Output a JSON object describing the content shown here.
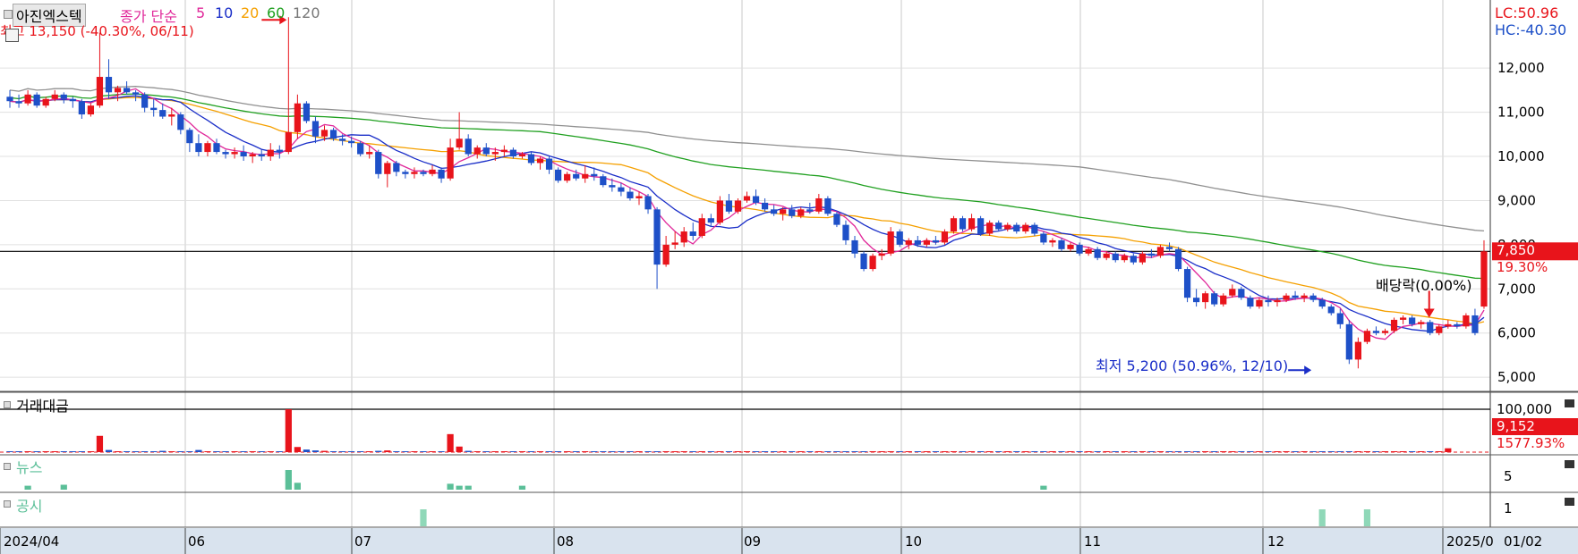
{
  "header": {
    "stock_name": "아진엑스텍",
    "ma_title": "종가 단순",
    "ma_periods": [
      "5",
      "10",
      "20",
      "60",
      "120"
    ],
    "high_marker": "최고 13,150 (-40.30%, 06/11)"
  },
  "right_info": {
    "lc": "LC:50.96",
    "hc": "HC:-40.30",
    "price_label": "7,850",
    "price_change": "19.30%",
    "dividend": "배당락(0.00%)"
  },
  "low_marker": "최저 5,200 (50.96%, 12/10)",
  "panels": {
    "volume_title": "거래대금",
    "volume_axis": "100,000",
    "volume_value": "9,152",
    "volume_change": "1577.93%",
    "news_title": "뉴스",
    "news_axis": "5",
    "disclosure_title": "공시",
    "disclosure_axis": "1"
  },
  "x_axis_labels": [
    "2024/04",
    "06",
    "07",
    "08",
    "09",
    "10",
    "11",
    "12",
    "2025/0",
    "01/02"
  ],
  "colors": {
    "up": "#e8141b",
    "down": "#1e50c8",
    "ma5": "#e0289a",
    "ma10": "#1a2ec8",
    "ma20": "#f5a000",
    "ma60": "#20a020",
    "ma120": "#909090",
    "news": "#5bbf98"
  },
  "chart_data": {
    "type": "candlestick",
    "y_ticks": [
      "12,000",
      "11,000",
      "10,000",
      "9,000",
      "8,000",
      "7,000",
      "6,000",
      "5,000"
    ],
    "ylim": [
      4700,
      13500
    ],
    "reference_price": 7850,
    "candles": [
      [
        11350,
        11500,
        11100,
        11250
      ],
      [
        11250,
        11400,
        11100,
        11200
      ],
      [
        11200,
        11500,
        11150,
        11400
      ],
      [
        11400,
        11450,
        11100,
        11150
      ],
      [
        11150,
        11350,
        11100,
        11300
      ],
      [
        11300,
        11500,
        11250,
        11400
      ],
      [
        11400,
        11450,
        11200,
        11300
      ],
      [
        11300,
        11350,
        11100,
        11250
      ],
      [
        11250,
        11300,
        10850,
        10950
      ],
      [
        10950,
        11200,
        10900,
        11150
      ],
      [
        11150,
        12800,
        11100,
        11800
      ],
      [
        11800,
        12200,
        11300,
        11450
      ],
      [
        11450,
        11600,
        11250,
        11550
      ],
      [
        11550,
        11700,
        11400,
        11450
      ],
      [
        11450,
        11500,
        11250,
        11400
      ],
      [
        11400,
        11450,
        11000,
        11100
      ],
      [
        11100,
        11300,
        10900,
        11050
      ],
      [
        11050,
        11200,
        10850,
        10900
      ],
      [
        10900,
        11100,
        10700,
        10950
      ],
      [
        10950,
        11000,
        10500,
        10600
      ],
      [
        10600,
        10650,
        10100,
        10300
      ],
      [
        10300,
        10500,
        10000,
        10100
      ],
      [
        10100,
        10350,
        10000,
        10300
      ],
      [
        10300,
        10400,
        10050,
        10100
      ],
      [
        10100,
        10150,
        9950,
        10050
      ],
      [
        10050,
        10200,
        9950,
        10100
      ],
      [
        10100,
        10250,
        9900,
        10000
      ],
      [
        10000,
        10100,
        9850,
        10050
      ],
      [
        10050,
        10150,
        9900,
        10000
      ],
      [
        10000,
        10300,
        9900,
        10150
      ],
      [
        10150,
        10250,
        9950,
        10100
      ],
      [
        10100,
        13150,
        10050,
        10550
      ],
      [
        10550,
        11400,
        10400,
        11200
      ],
      [
        11200,
        11250,
        10750,
        10800
      ],
      [
        10800,
        10900,
        10300,
        10450
      ],
      [
        10450,
        10700,
        10350,
        10600
      ],
      [
        10600,
        10650,
        10350,
        10400
      ],
      [
        10400,
        10500,
        10250,
        10350
      ],
      [
        10350,
        10450,
        10200,
        10300
      ],
      [
        10300,
        10350,
        10000,
        10050
      ],
      [
        10050,
        10250,
        9950,
        10100
      ],
      [
        10100,
        10150,
        9500,
        9600
      ],
      [
        9600,
        9900,
        9300,
        9850
      ],
      [
        9850,
        9900,
        9550,
        9650
      ],
      [
        9650,
        9700,
        9500,
        9600
      ],
      [
        9600,
        9750,
        9500,
        9650
      ],
      [
        9650,
        9700,
        9550,
        9600
      ],
      [
        9600,
        9800,
        9550,
        9700
      ],
      [
        9700,
        9750,
        9400,
        9500
      ],
      [
        9500,
        10400,
        9450,
        10200
      ],
      [
        10200,
        11000,
        10150,
        10400
      ],
      [
        10400,
        10500,
        10000,
        10050
      ],
      [
        10050,
        10250,
        9950,
        10200
      ],
      [
        10200,
        10300,
        10000,
        10050
      ],
      [
        10050,
        10200,
        9900,
        10100
      ],
      [
        10100,
        10250,
        10000,
        10150
      ],
      [
        10150,
        10200,
        9950,
        10000
      ],
      [
        10000,
        10100,
        9950,
        10050
      ],
      [
        10050,
        10100,
        9800,
        9850
      ],
      [
        9850,
        10000,
        9700,
        9950
      ],
      [
        9950,
        10000,
        9600,
        9700
      ],
      [
        9700,
        9750,
        9400,
        9450
      ],
      [
        9450,
        9650,
        9400,
        9600
      ],
      [
        9600,
        9700,
        9450,
        9500
      ],
      [
        9500,
        9800,
        9400,
        9600
      ],
      [
        9600,
        9750,
        9450,
        9550
      ],
      [
        9550,
        9600,
        9300,
        9350
      ],
      [
        9350,
        9500,
        9200,
        9300
      ],
      [
        9300,
        9400,
        9100,
        9200
      ],
      [
        9200,
        9300,
        9000,
        9050
      ],
      [
        9050,
        9200,
        8900,
        9100
      ],
      [
        9100,
        9150,
        8700,
        8800
      ],
      [
        8800,
        8850,
        7000,
        7550
      ],
      [
        7550,
        8200,
        7500,
        8000
      ],
      [
        8000,
        8300,
        7900,
        8050
      ],
      [
        8050,
        8400,
        7950,
        8300
      ],
      [
        8300,
        8500,
        8100,
        8200
      ],
      [
        8200,
        8700,
        8150,
        8600
      ],
      [
        8600,
        8700,
        8400,
        8500
      ],
      [
        8500,
        9100,
        8450,
        9000
      ],
      [
        9000,
        9150,
        8700,
        8750
      ],
      [
        8750,
        9050,
        8700,
        9000
      ],
      [
        9000,
        9200,
        8950,
        9100
      ],
      [
        9100,
        9250,
        8900,
        8950
      ],
      [
        8950,
        9050,
        8750,
        8800
      ],
      [
        8800,
        8900,
        8650,
        8700
      ],
      [
        8700,
        8850,
        8550,
        8800
      ],
      [
        8800,
        8900,
        8600,
        8650
      ],
      [
        8650,
        8850,
        8600,
        8800
      ],
      [
        8800,
        8950,
        8700,
        8750
      ],
      [
        8750,
        9150,
        8700,
        9050
      ],
      [
        9050,
        9100,
        8650,
        8700
      ],
      [
        8700,
        8750,
        8400,
        8450
      ],
      [
        8450,
        8550,
        8000,
        8100
      ],
      [
        8100,
        8200,
        7700,
        7800
      ],
      [
        7800,
        7850,
        7400,
        7450
      ],
      [
        7450,
        7800,
        7400,
        7750
      ],
      [
        7750,
        7900,
        7650,
        7800
      ],
      [
        7800,
        8400,
        7750,
        8300
      ],
      [
        8300,
        8350,
        7950,
        8000
      ],
      [
        8000,
        8150,
        7900,
        8100
      ],
      [
        8100,
        8200,
        7950,
        8000
      ],
      [
        8000,
        8150,
        7950,
        8100
      ],
      [
        8100,
        8200,
        8000,
        8050
      ],
      [
        8050,
        8350,
        8000,
        8300
      ],
      [
        8300,
        8650,
        8250,
        8600
      ],
      [
        8600,
        8650,
        8300,
        8350
      ],
      [
        8350,
        8700,
        8300,
        8600
      ],
      [
        8600,
        8650,
        8200,
        8250
      ],
      [
        8250,
        8550,
        8200,
        8500
      ],
      [
        8500,
        8550,
        8300,
        8350
      ],
      [
        8350,
        8500,
        8300,
        8450
      ],
      [
        8450,
        8500,
        8250,
        8300
      ],
      [
        8300,
        8500,
        8250,
        8450
      ],
      [
        8450,
        8500,
        8200,
        8250
      ],
      [
        8250,
        8300,
        8000,
        8050
      ],
      [
        8050,
        8150,
        7950,
        8100
      ],
      [
        8100,
        8150,
        7850,
        7900
      ],
      [
        7900,
        8050,
        7850,
        8000
      ],
      [
        8000,
        8050,
        7750,
        7800
      ],
      [
        7800,
        7950,
        7750,
        7900
      ],
      [
        7900,
        7950,
        7650,
        7700
      ],
      [
        7700,
        7850,
        7650,
        7800
      ],
      [
        7800,
        7850,
        7600,
        7650
      ],
      [
        7650,
        7800,
        7600,
        7750
      ],
      [
        7750,
        7800,
        7550,
        7600
      ],
      [
        7600,
        7850,
        7550,
        7800
      ],
      [
        7800,
        7900,
        7700,
        7750
      ],
      [
        7750,
        8000,
        7700,
        7950
      ],
      [
        7950,
        8050,
        7850,
        7900
      ],
      [
        7900,
        7950,
        7400,
        7450
      ],
      [
        7450,
        7500,
        6700,
        6800
      ],
      [
        6800,
        7000,
        6600,
        6700
      ],
      [
        6700,
        6950,
        6550,
        6900
      ],
      [
        6900,
        6950,
        6600,
        6650
      ],
      [
        6650,
        6900,
        6600,
        6850
      ],
      [
        6850,
        7100,
        6800,
        7000
      ],
      [
        7000,
        7050,
        6750,
        6800
      ],
      [
        6800,
        6850,
        6550,
        6600
      ],
      [
        6600,
        6800,
        6550,
        6750
      ],
      [
        6750,
        6850,
        6600,
        6700
      ],
      [
        6700,
        6800,
        6600,
        6750
      ],
      [
        6750,
        6900,
        6700,
        6850
      ],
      [
        6850,
        6950,
        6750,
        6800
      ],
      [
        6800,
        6900,
        6700,
        6850
      ],
      [
        6850,
        6900,
        6700,
        6750
      ],
      [
        6750,
        6800,
        6550,
        6600
      ],
      [
        6600,
        6650,
        6400,
        6450
      ],
      [
        6450,
        6550,
        6100,
        6200
      ],
      [
        6200,
        6300,
        5300,
        5400
      ],
      [
        5400,
        5900,
        5200,
        5800
      ],
      [
        5800,
        6100,
        5750,
        6050
      ],
      [
        6050,
        6150,
        5950,
        6000
      ],
      [
        6000,
        6100,
        5950,
        6050
      ],
      [
        6050,
        6350,
        6000,
        6300
      ],
      [
        6300,
        6400,
        6200,
        6350
      ],
      [
        6350,
        6400,
        6150,
        6200
      ],
      [
        6200,
        6300,
        6100,
        6250
      ],
      [
        6250,
        6300,
        5950,
        6000
      ],
      [
        6000,
        6200,
        5950,
        6150
      ],
      [
        6150,
        6300,
        6100,
        6200
      ],
      [
        6200,
        6250,
        6100,
        6150
      ],
      [
        6150,
        6450,
        6100,
        6400
      ],
      [
        6400,
        6550,
        5950,
        6000
      ],
      [
        6600,
        8100,
        6550,
        7850
      ]
    ],
    "volume": [
      0.02,
      0.01,
      0.01,
      0.01,
      0.01,
      0.01,
      0.01,
      0.01,
      0.01,
      0.01,
      0.38,
      0.05,
      0.02,
      0.02,
      0.01,
      0.01,
      0.01,
      0.03,
      0.01,
      0.01,
      0.02,
      0.05,
      0.01,
      0.01,
      0.01,
      0.01,
      0.01,
      0.01,
      0.01,
      0.01,
      0.01,
      1.0,
      0.12,
      0.06,
      0.04,
      0.03,
      0.02,
      0.02,
      0.02,
      0.01,
      0.01,
      0.03,
      0.04,
      0.02,
      0.01,
      0.01,
      0.01,
      0.01,
      0.01,
      0.42,
      0.13,
      0.03,
      0.01,
      0.01,
      0.01,
      0.01,
      0.01,
      0.02,
      0.01,
      0.01,
      0.01,
      0.01,
      0.01,
      0.01,
      0.01,
      0.01,
      0.01,
      0.01,
      0.01,
      0.01,
      0.01,
      0.01,
      0.01,
      0.01,
      0.01,
      0.01,
      0.01,
      0.01,
      0.01,
      0.01,
      0.01,
      0.01,
      0.01,
      0.01,
      0.01,
      0.01,
      0.01,
      0.01,
      0.01,
      0.01,
      0.01,
      0.01,
      0.01,
      0.01,
      0.01,
      0.01,
      0.01,
      0.01,
      0.01,
      0.01,
      0.01,
      0.01,
      0.01,
      0.01,
      0.01,
      0.01,
      0.01,
      0.01,
      0.01,
      0.01,
      0.01,
      0.01,
      0.01,
      0.01,
      0.01,
      0.01,
      0.01,
      0.01,
      0.01,
      0.01,
      0.01,
      0.01,
      0.01,
      0.01,
      0.01,
      0.01,
      0.01,
      0.01,
      0.01,
      0.01,
      0.01,
      0.01,
      0.01,
      0.01,
      0.01,
      0.01,
      0.01,
      0.01,
      0.01,
      0.01,
      0.01,
      0.01,
      0.01,
      0.01,
      0.01,
      0.01,
      0.01,
      0.01,
      0.01,
      0.01,
      0.01,
      0.01,
      0.01,
      0.01,
      0.01,
      0.01,
      0.01,
      0.01,
      0.01,
      0.01,
      0.09
    ],
    "news": {
      "indices": [
        2,
        6,
        31,
        32,
        49,
        50,
        51,
        57,
        115
      ],
      "heights": [
        0.2,
        0.25,
        1.0,
        0.35,
        0.3,
        0.2,
        0.2,
        0.2,
        0.2
      ]
    },
    "disclosures": {
      "indices": [
        46,
        146,
        151
      ],
      "heights": [
        1,
        1,
        1
      ]
    }
  }
}
